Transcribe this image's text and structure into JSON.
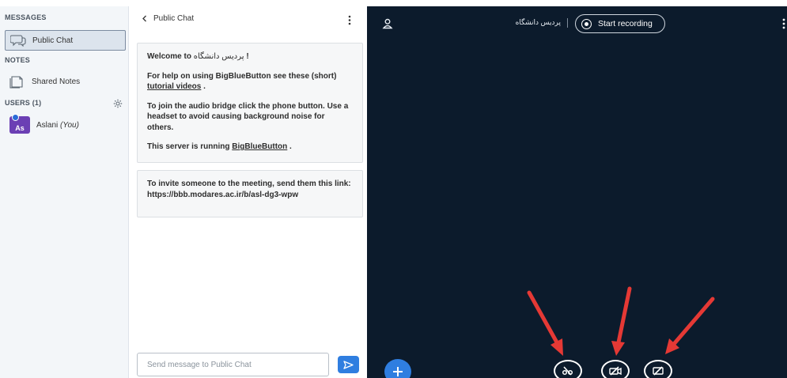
{
  "sidebar": {
    "messages_title": "MESSAGES",
    "public_chat_label": "Public Chat",
    "notes_title": "NOTES",
    "shared_notes_label": "Shared Notes",
    "users_title": "USERS (1)",
    "users": [
      {
        "initials": "As",
        "name": "Aslani",
        "you_label": "(You)"
      }
    ]
  },
  "chat": {
    "back_label": "Public Chat",
    "welcome": {
      "line1_prefix": "Welcome to ",
      "line1_name": "پردیس دانشگاه",
      "line1_suffix": "!",
      "help_text": "For help on using BigBlueButton see these (short) ",
      "help_link": "tutorial videos",
      "help_end": ".",
      "audio_text": "To join the audio bridge click the phone button. Use a headset to avoid causing background noise for others.",
      "server_text": "This server is running ",
      "server_link": "BigBlueButton",
      "server_end": "."
    },
    "invite_text": "To invite someone to the meeting, send them this link: https://bbb.modares.ac.ir/b/asl-dg3-wpw",
    "input_placeholder": "Send message to Public Chat"
  },
  "main": {
    "meeting_title": "پردیس دانشگاه",
    "record_label": "Start recording"
  },
  "colors": {
    "accent": "#2f7ee0",
    "dark_bg": "#0c1b2c",
    "annotation_arrow": "#e53935",
    "avatar": "#6b3fb4"
  },
  "icons": {
    "public_chat": "chat-bubble-icon",
    "shared_notes": "notes-icon",
    "user_settings": "gear-icon",
    "send": "send-icon",
    "presenter": "user-icon",
    "actions": "plus-icon",
    "mute": "microphone-muted-icon",
    "camera": "camera-off-icon",
    "screenshare": "screenshare-off-icon"
  }
}
